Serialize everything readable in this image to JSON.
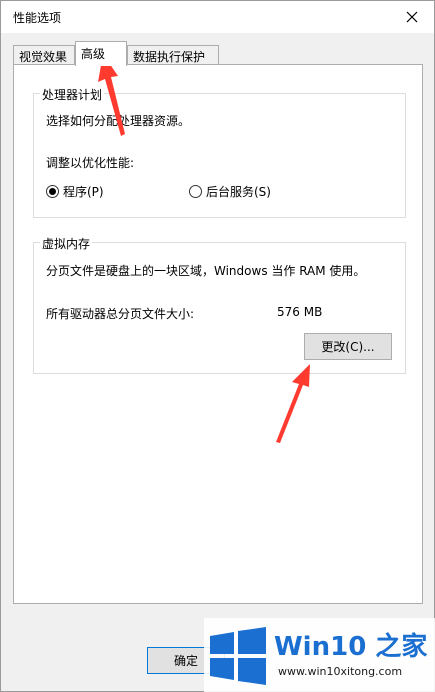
{
  "dialog": {
    "title": "性能选项",
    "tabs": [
      {
        "label": "视觉效果",
        "active": false
      },
      {
        "label": "高级",
        "active": true
      },
      {
        "label": "数据执行保护",
        "active": false
      }
    ]
  },
  "processor": {
    "group_title": "处理器计划",
    "description": "选择如何分配处理器资源。",
    "adjust_label": "调整以优化性能:",
    "options": [
      {
        "label": "程序(P)",
        "checked": true
      },
      {
        "label": "后台服务(S)",
        "checked": false
      }
    ]
  },
  "virtual_memory": {
    "group_title": "虚拟内存",
    "description": "分页文件是硬盘上的一块区域，Windows 当作 RAM 使用。",
    "total_label": "所有驱动器总分页文件大小:",
    "total_value": "576 MB",
    "change_button": "更改(C)..."
  },
  "footer": {
    "ok_button": "确定"
  },
  "watermark": {
    "brand": "Win10 之家",
    "url": "www.win10xitong.com"
  },
  "colors": {
    "accent": "#0078d7",
    "arrow": "#ff3b30",
    "brand_blue": "#1a6fd1"
  }
}
